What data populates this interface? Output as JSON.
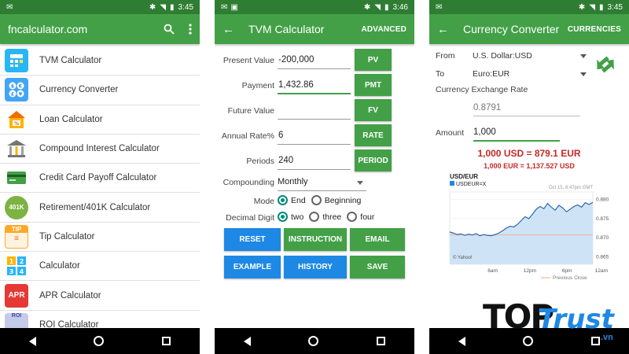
{
  "colors": {
    "appbar": "#43a047",
    "statusbar": "#2e7d32",
    "button_green": "#43a047",
    "button_blue": "#1e88e5",
    "result_red": "#c62828",
    "brand_blue": "#1e88e5"
  },
  "panel1": {
    "time": "3:45",
    "title": "fncalculator.com",
    "items": [
      {
        "label": "TVM Calculator",
        "icon": "tvm-icon",
        "color": "#29b6f6"
      },
      {
        "label": "Currency Converter",
        "icon": "currency-icon",
        "color": "#42a5f5"
      },
      {
        "label": "Loan Calculator",
        "icon": "loan-icon",
        "color": "#ffb300"
      },
      {
        "label": "Compound Interest Calculator",
        "icon": "bank-icon",
        "color": "#9e9e9e"
      },
      {
        "label": "Credit Card Payoff Calculator",
        "icon": "credit-card-icon",
        "color": "#43a047"
      },
      {
        "label": "Retirement/401K Calculator",
        "icon": "retirement-icon",
        "color": "#7cb342"
      },
      {
        "label": "Tip Calculator",
        "icon": "tip-icon",
        "color": "#ffa726"
      },
      {
        "label": "Calculator",
        "icon": "calculator-icon",
        "color": "#29b6f6"
      },
      {
        "label": "APR Calculator",
        "icon": "apr-icon",
        "color": "#e53935"
      },
      {
        "label": "ROI Calculator",
        "icon": "roi-icon",
        "color": "#5c6bc0"
      }
    ],
    "icon_text": {
      "k401": "401K",
      "tip": "TIP",
      "apr": "APR",
      "roi": "ROI"
    }
  },
  "panel2": {
    "time": "3:46",
    "title": "TVM Calculator",
    "action": "ADVANCED",
    "rows": [
      {
        "label": "Present Value",
        "value": "-200,000",
        "button": "PV"
      },
      {
        "label": "Payment",
        "value": "1,432.86",
        "button": "PMT"
      },
      {
        "label": "Future Value",
        "value": "",
        "button": "FV"
      },
      {
        "label": "Annual Rate%",
        "value": "6",
        "button": "RATE"
      },
      {
        "label": "Periods",
        "value": "240",
        "button": "PERIOD"
      }
    ],
    "compounding_label": "Compounding",
    "compounding_value": "Monthly",
    "mode_label": "Mode",
    "mode_options": [
      "End",
      "Beginning"
    ],
    "decimal_label": "Decimal Digit",
    "decimal_options": [
      "two",
      "three",
      "four"
    ],
    "buttons": [
      "RESET",
      "INSTRUCTION",
      "EMAIL",
      "EXAMPLE",
      "HISTORY",
      "SAVE"
    ]
  },
  "panel3": {
    "time": "3:45",
    "title": "Currency Converter",
    "action": "CURRENCIES",
    "from_label": "From",
    "from_value": "U.S. Dollar:USD",
    "to_label": "To",
    "to_value": "Euro:EUR",
    "rate_label": "Currency Exchange Rate",
    "rate_value": "0.8791",
    "amount_label": "Amount",
    "amount_value": "1,000",
    "result_main": "1,000 USD = 879.1 EUR",
    "result_inverse": "1,000 EUR = 1,137.527 USD"
  },
  "chart_data": {
    "type": "line",
    "title": "USD/EUR",
    "subtitle": "USDEUR=X",
    "timestamp": "Oct 15, 8:47pm GMT",
    "x": [
      "6am",
      "12pm",
      "6pm",
      "12am"
    ],
    "y_ticks": [
      0.865,
      0.87,
      0.875,
      0.88
    ],
    "ylim": [
      0.863,
      0.882
    ],
    "values": [
      0.8715,
      0.8712,
      0.8708,
      0.871,
      0.8706,
      0.8709,
      0.8707,
      0.8711,
      0.8705,
      0.8708,
      0.8706,
      0.8705,
      0.8708,
      0.8712,
      0.8718,
      0.8725,
      0.873,
      0.8728,
      0.8735,
      0.8745,
      0.8755,
      0.875,
      0.8762,
      0.8775,
      0.8782,
      0.8776,
      0.879,
      0.878,
      0.8772,
      0.8785,
      0.8778,
      0.8768,
      0.8775,
      0.8782,
      0.8786,
      0.878,
      0.8792,
      0.8787,
      0.8793
    ],
    "previous_close": 0.8707,
    "previous_close_label": "Previous Close",
    "source": "© Yahoo!",
    "grid": true
  },
  "logo": {
    "top": "TOP",
    "trust": "Trust",
    "vn": ".vn"
  }
}
